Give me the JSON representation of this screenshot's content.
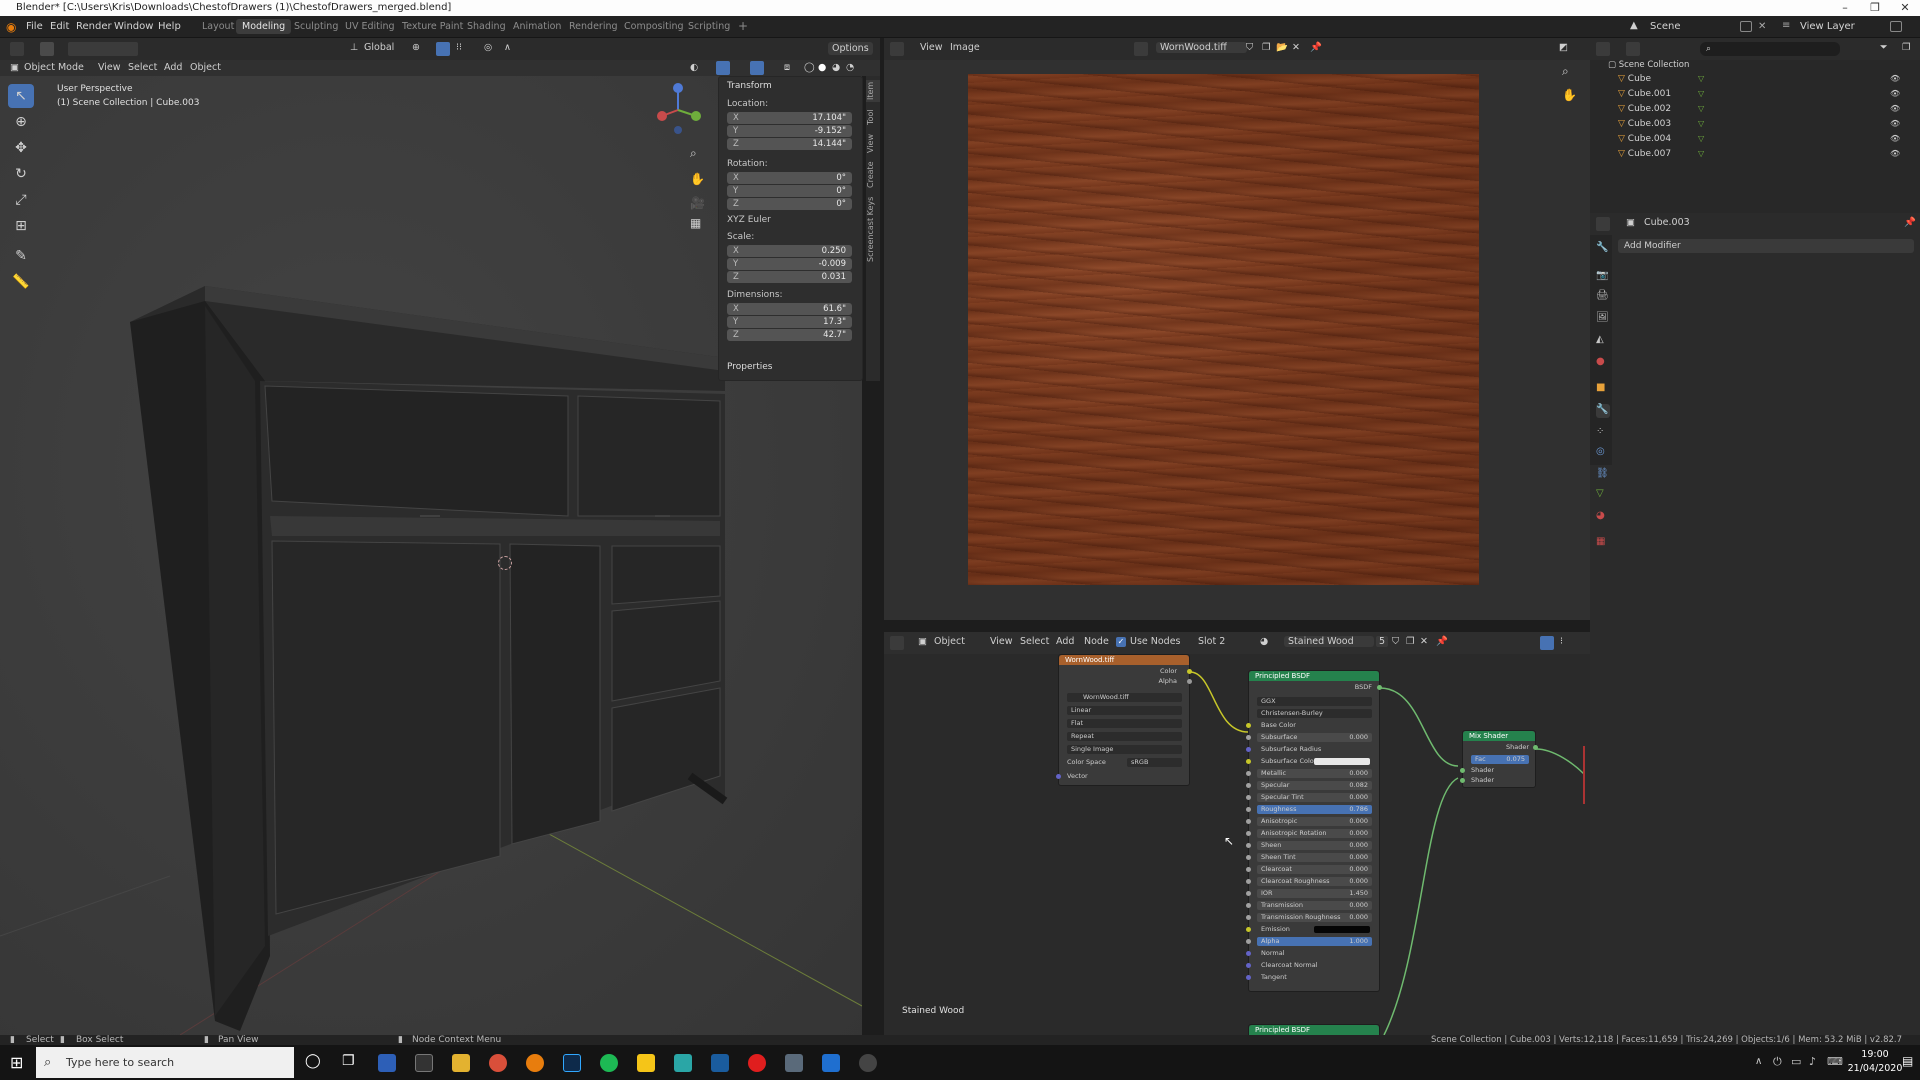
{
  "window": {
    "title": "Blender* [C:\\Users\\Kris\\Downloads\\ChestofDrawers (1)\\ChestofDrawers_merged.blend]"
  },
  "menubar": {
    "items": [
      "File",
      "Edit",
      "Render",
      "Window",
      "Help"
    ],
    "workspaces": [
      "Layout",
      "Modeling",
      "Sculpting",
      "UV Editing",
      "Texture Paint",
      "Shading",
      "Animation",
      "Rendering",
      "Compositing",
      "Scripting"
    ],
    "active_workspace": "Modeling",
    "scene": "Scene",
    "view_layer": "View Layer"
  },
  "viewport": {
    "mode": "Object Mode",
    "menus": [
      "View",
      "Select",
      "Add",
      "Object"
    ],
    "orientation": "Global",
    "options": "Options",
    "perspective_label": "User Perspective",
    "collection_label": "(1) Scene Collection | Cube.003"
  },
  "npanel": {
    "transform_header": "Transform",
    "location_label": "Location:",
    "location": [
      {
        "axis": "X",
        "value": "17.104\""
      },
      {
        "axis": "Y",
        "value": "-9.152\""
      },
      {
        "axis": "Z",
        "value": "14.144\""
      }
    ],
    "rotation_label": "Rotation:",
    "rotation": [
      {
        "axis": "X",
        "value": "0°"
      },
      {
        "axis": "Y",
        "value": "0°"
      },
      {
        "axis": "Z",
        "value": "0°"
      }
    ],
    "rotation_mode": "XYZ Euler",
    "scale_label": "Scale:",
    "scale": [
      {
        "axis": "X",
        "value": "0.250"
      },
      {
        "axis": "Y",
        "value": "-0.009"
      },
      {
        "axis": "Z",
        "value": "0.031"
      }
    ],
    "dimensions_label": "Dimensions:",
    "dimensions": [
      {
        "axis": "X",
        "value": "61.6\""
      },
      {
        "axis": "Y",
        "value": "17.3\""
      },
      {
        "axis": "Z",
        "value": "42.7\""
      }
    ],
    "properties_header": "Properties",
    "tabs": [
      "Item",
      "Tool",
      "View",
      "Create",
      "Screencast Keys"
    ]
  },
  "image_editor": {
    "menus": [
      "View",
      "Image"
    ],
    "image_name": "WornWood.tiff"
  },
  "node_editor": {
    "type": "Object",
    "menus": [
      "View",
      "Select",
      "Add",
      "Node"
    ],
    "use_nodes": "Use Nodes",
    "slot": "Slot 2",
    "material": "Stained Wood",
    "users": "5",
    "footer_label": "Stained Wood",
    "image_node": {
      "title": "WornWood.tiff",
      "outputs": [
        "Color",
        "Alpha"
      ],
      "image": "WornWood.tiff",
      "interpolation": "Linear",
      "projection": "Flat",
      "extension": "Repeat",
      "source": "Single Image",
      "color_space_label": "Color Space",
      "color_space": "sRGB",
      "vector": "Vector"
    },
    "bsdf_node": {
      "title": "Principled BSDF",
      "output": "BSDF",
      "distribution": "GGX",
      "subsurface_method": "Christensen-Burley",
      "rows": [
        {
          "label": "Base Color",
          "value": ""
        },
        {
          "label": "Subsurface",
          "value": "0.000"
        },
        {
          "label": "Subsurface Radius",
          "value": ""
        },
        {
          "label": "Subsurface Color",
          "value": ""
        },
        {
          "label": "Metallic",
          "value": "0.000"
        },
        {
          "label": "Specular",
          "value": "0.082"
        },
        {
          "label": "Specular Tint",
          "value": "0.000"
        },
        {
          "label": "Roughness",
          "value": "0.786"
        },
        {
          "label": "Anisotropic",
          "value": "0.000"
        },
        {
          "label": "Anisotropic Rotation",
          "value": "0.000"
        },
        {
          "label": "Sheen",
          "value": "0.000"
        },
        {
          "label": "Sheen Tint",
          "value": "0.000"
        },
        {
          "label": "Clearcoat",
          "value": "0.000"
        },
        {
          "label": "Clearcoat Roughness",
          "value": "0.000"
        },
        {
          "label": "IOR",
          "value": "1.450"
        },
        {
          "label": "Transmission",
          "value": "0.000"
        },
        {
          "label": "Transmission Roughness",
          "value": "0.000"
        },
        {
          "label": "Emission",
          "value": ""
        },
        {
          "label": "Alpha",
          "value": "1.000"
        },
        {
          "label": "Normal",
          "value": ""
        },
        {
          "label": "Clearcoat Normal",
          "value": ""
        },
        {
          "label": "Tangent",
          "value": ""
        }
      ]
    },
    "mix_node": {
      "title": "Mix Shader",
      "output": "Shader",
      "fac_label": "Fac",
      "fac": "0.075",
      "inputs": [
        "Shader",
        "Shader"
      ]
    },
    "bsdf2_title": "Principled BSDF"
  },
  "outliner": {
    "root": "Scene Collection",
    "items": [
      "Cube",
      "Cube.001",
      "Cube.002",
      "Cube.003",
      "Cube.004",
      "Cube.007"
    ]
  },
  "properties": {
    "object": "Cube.003",
    "add_modifier": "Add Modifier"
  },
  "statusbar": {
    "left": [
      "Select",
      "Box Select",
      "Pan View",
      "Node Context Menu"
    ],
    "right": "Scene Collection | Cube.003 | Verts:12,118 | Faces:11,659 | Tris:24,269 | Objects:1/6 | Mem: 53.2 MiB | v2.82.7"
  },
  "taskbar": {
    "search_placeholder": "Type here to search",
    "time": "19:00",
    "date": "21/04/2020"
  },
  "colors": {
    "accent": "#4772b3",
    "node_green": "#25824d",
    "image_node_header": "#a8602c"
  }
}
